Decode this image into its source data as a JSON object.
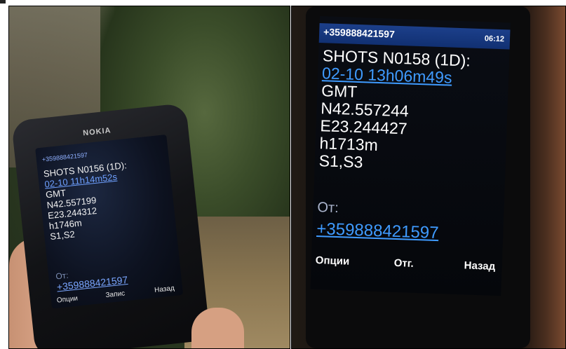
{
  "photo_left": {
    "brand": "NOKIA",
    "sender": "+359888421597",
    "message_lines": [
      "SHOTS N0156 (1D):",
      "02-10 11h14m52s",
      "GMT",
      "N42.557199",
      "E23.244312",
      "h1746m",
      "S1,S2"
    ],
    "from_label": "От:",
    "from_number": "+359888421597",
    "softkeys": [
      "Опции",
      "Запис",
      "Назад"
    ]
  },
  "photo_right": {
    "sender": "+359888421597",
    "time": "06:12",
    "message_lines": [
      "SHOTS N0158 (1D):",
      "02-10 13h06m49s",
      "GMT",
      "N42.557244",
      "E23.244427",
      "h1713m",
      "S1,S3"
    ],
    "from_label": "От:",
    "from_number": "+359888421597",
    "softkeys": [
      "Опции",
      "Отг.",
      "Назад"
    ]
  },
  "colors": {
    "screen_link": "#3f9bff",
    "header_bar": "#1c3f8a"
  }
}
